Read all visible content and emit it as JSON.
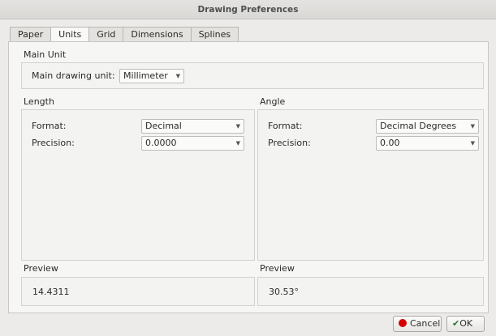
{
  "window": {
    "title": "Drawing Preferences"
  },
  "tabs": [
    {
      "label": "Paper",
      "active": false
    },
    {
      "label": "Units",
      "active": true
    },
    {
      "label": "Grid",
      "active": false
    },
    {
      "label": "Dimensions",
      "active": false
    },
    {
      "label": "Splines",
      "active": false
    }
  ],
  "main_unit": {
    "section_label": "Main Unit",
    "field_label": "Main drawing unit:",
    "value": "Millimeter"
  },
  "length": {
    "section_label": "Length",
    "format_label": "Format:",
    "format_value": "Decimal",
    "precision_label": "Precision:",
    "precision_value": "0.0000",
    "preview_label": "Preview",
    "preview_value": "14.4311"
  },
  "angle": {
    "section_label": "Angle",
    "format_label": "Format:",
    "format_value": "Decimal Degrees",
    "precision_label": "Precision:",
    "precision_value": "0.00",
    "preview_label": "Preview",
    "preview_value": "30.53°"
  },
  "buttons": {
    "cancel_label": "Cancel",
    "ok_label": "OK"
  },
  "icons": {
    "cancel": "red-stop-icon",
    "ok": "green-check-icon",
    "dropdown": "chevron-down-icon"
  },
  "colors": {
    "cancel_icon": "#d40000",
    "ok_icon": "#2f6f2f"
  }
}
